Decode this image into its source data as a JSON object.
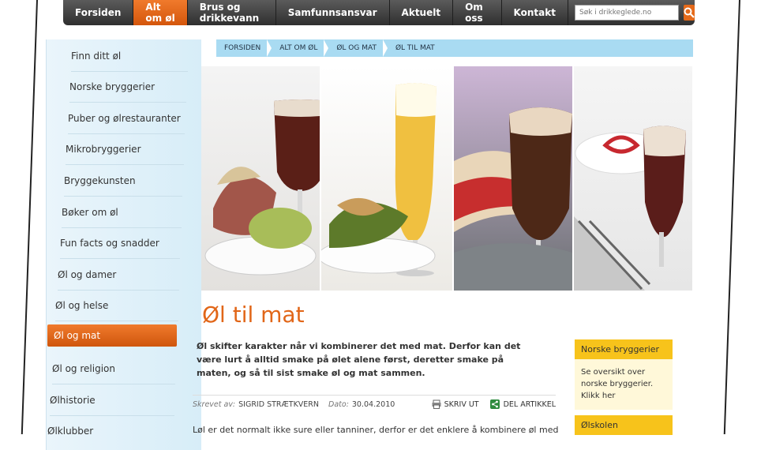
{
  "nav": {
    "items": [
      "Forsiden",
      "Alt om øl",
      "Brus og drikkevann",
      "Samfunnsansvar",
      "Aktuelt",
      "Om oss",
      "Kontakt"
    ],
    "active_index": 1,
    "search_placeholder": "Søk i drikkeglede.no"
  },
  "sidebar": {
    "items": [
      "Finn ditt øl",
      "Norske bryggerier",
      "Puber og ølrestauranter",
      "Mikrobryggerier",
      "Bryggekunsten",
      "Bøker om øl",
      "Fun facts og snadder",
      "Øl og damer",
      "Øl og helse",
      "Øl og mat",
      "Øl og religion",
      "Ølhistorie",
      "Ølklubber"
    ],
    "active_index": 9
  },
  "breadcrumb": [
    "FORSIDEN",
    "ALT OM ØL",
    "ØL OG MAT",
    "ØL TIL MAT"
  ],
  "article": {
    "title": "Øl til mat",
    "lead": "Øl skifter karakter når vi kombinerer det med mat. Derfor kan det være lurt å alltid smake på ølet alene først, deretter smake på maten, og så til sist smake øl og mat sammen.",
    "author_label": "Skrevet av:",
    "author": "SIGRID STRÆTKVERN",
    "date_label": "Dato:",
    "date": "30.04.2010",
    "print_label": "SKRIV UT",
    "share_label": "DEL ARTIKKEL",
    "body_start": "Løl er det normalt ikke sure eller tanniner, derfor er det enklere å kombinere øl med"
  },
  "right_boxes": [
    {
      "title": "Norske bryggerier",
      "text": "Se oversikt over norske bryggerier. Klikk her"
    },
    {
      "title": "Ølskolen",
      "text": ""
    }
  ],
  "colors": {
    "accent": "#e16618",
    "nav_dark": "#3a3a3a",
    "breadcrumb": "#a9dbf2",
    "box_yellow": "#f7c31b"
  }
}
